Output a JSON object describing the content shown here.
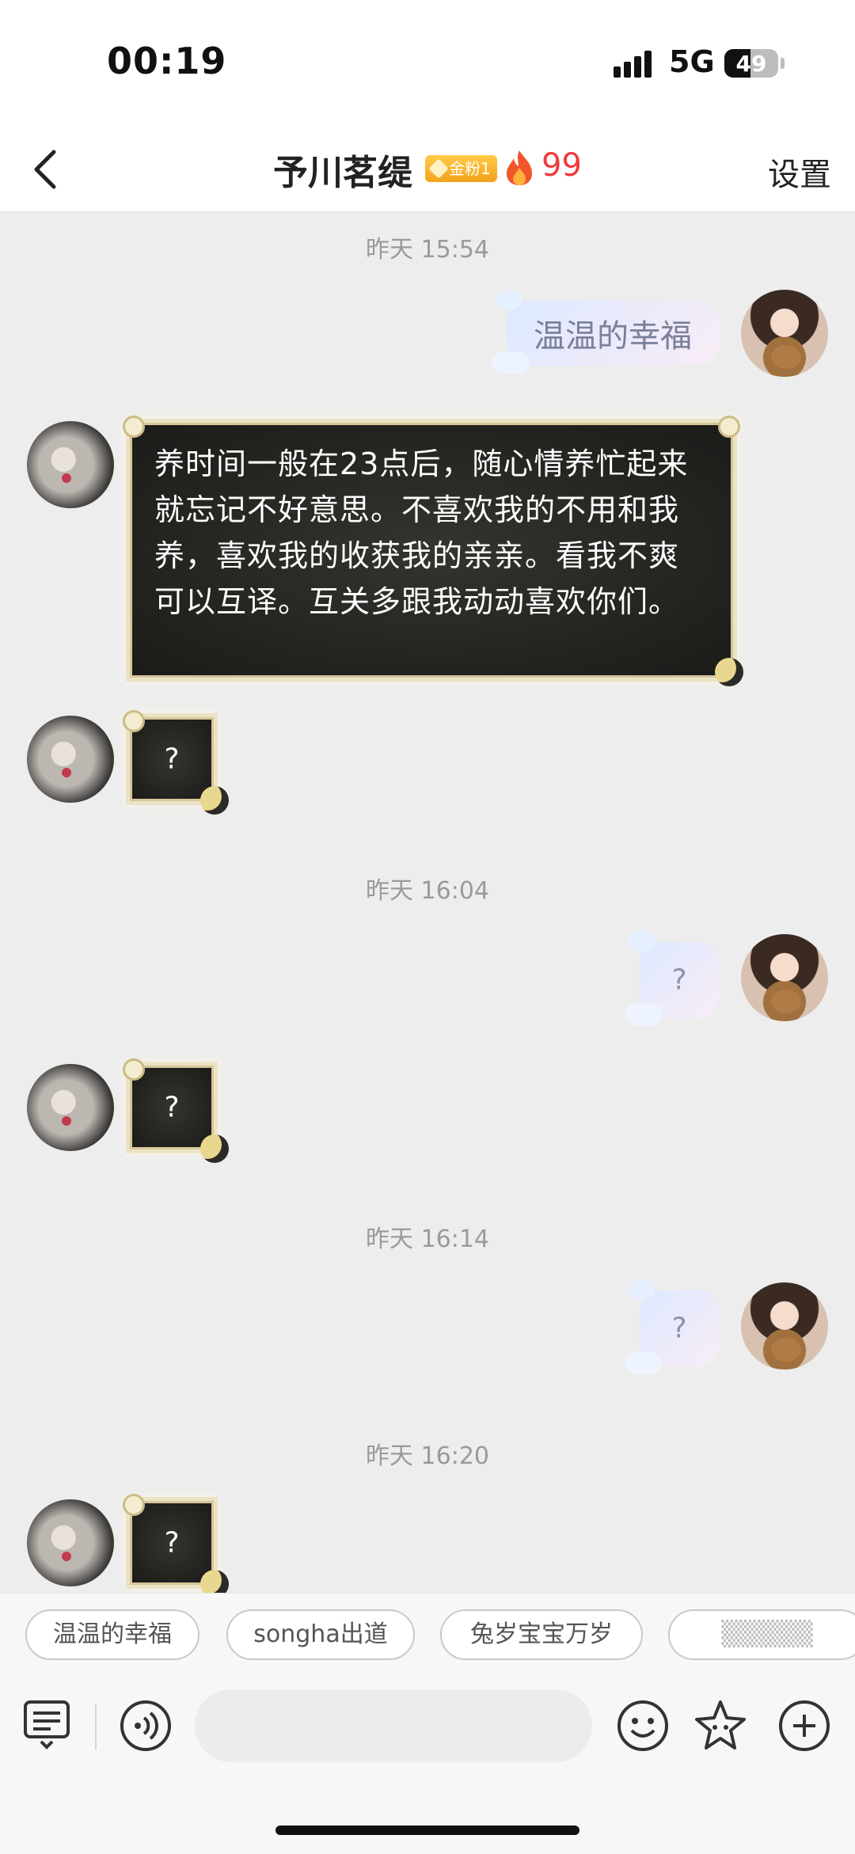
{
  "status": {
    "time": "00:19",
    "network": "5G",
    "battery": "49",
    "battery_level": 0.49
  },
  "header": {
    "title": "予川茗缇",
    "fan_badge": "金粉1",
    "heat": "99",
    "settings": "设置"
  },
  "chat": {
    "timestamps": [
      "昨天 15:54",
      "昨天 16:04",
      "昨天 16:14",
      "昨天 16:20"
    ],
    "messages": [
      {
        "from": "me",
        "text": "温温的幸福"
      },
      {
        "from": "her",
        "text": "养时间一般在23点后，随心情养忙起来就忘记不好意思。不喜欢我的不用和我养，喜欢我的收获我的亲亲。看我不爽可以互译。互关多跟我动动喜欢你们。"
      },
      {
        "from": "her",
        "text": "?"
      },
      {
        "from": "me",
        "text": "?"
      },
      {
        "from": "her",
        "text": "?"
      },
      {
        "from": "me",
        "text": "?"
      },
      {
        "from": "her",
        "text": "?"
      }
    ]
  },
  "quick_replies": [
    "温温的幸福",
    "songha出道",
    "兔岁宝宝万岁",
    "▒▒▒▒▒"
  ],
  "icons": [
    "back-icon",
    "fire-icon",
    "keyboard-icon",
    "voice-icon",
    "emoji-icon",
    "sticker-icon",
    "plus-icon"
  ]
}
